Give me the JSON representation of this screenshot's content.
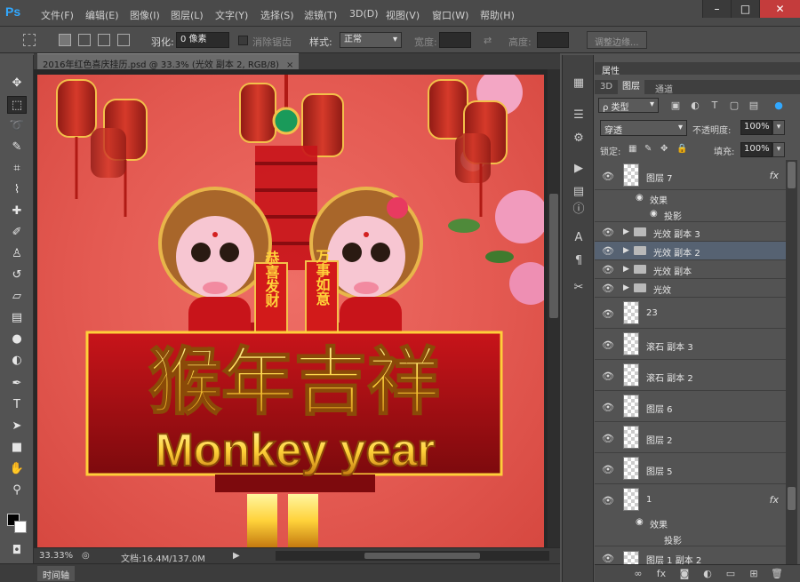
{
  "app": {
    "logo": "Ps",
    "menu": [
      "文件(F)",
      "编辑(E)",
      "图像(I)",
      "图层(L)",
      "文字(Y)",
      "选择(S)",
      "滤镜(T)",
      "3D(D)",
      "视图(V)",
      "窗口(W)",
      "帮助(H)"
    ],
    "window_buttons": [
      "–",
      "□",
      "✕"
    ]
  },
  "options": {
    "feather_label": "羽化:",
    "feather_value": "0 像素",
    "antialias_label": "消除锯齿",
    "style_label": "样式:",
    "style_value": "正常",
    "width_label": "宽度:",
    "height_label": "高度:",
    "refine_edge_label": "调整边缘..."
  },
  "document": {
    "tab_title": "2016年红色喜庆挂历.psd @ 33.3% (光效 副本 2, RGB/8)",
    "close": "×",
    "artwork": {
      "title_cn": "猴年吉祥",
      "title_en": "Monkey year",
      "scroll_left": "恭喜发财",
      "scroll_right": "万事如意"
    }
  },
  "status": {
    "zoom": "33.33%",
    "doc_info": "文档:16.4M/137.0M",
    "arrow": "▶"
  },
  "timeline": {
    "tab": "时间轴"
  },
  "panel": {
    "header": "属性",
    "tabs": [
      "3D",
      "图层",
      "通道"
    ],
    "active_tab": "图层",
    "kind_filter": "ρ 类型",
    "blend_mode": "穿透",
    "opacity_label": "不透明度:",
    "opacity_value": "100%",
    "lock_label": "锁定:",
    "fill_label": "填充:",
    "fill_value": "100%",
    "dropdown_arrow": "▾",
    "fx_label": "fx",
    "layers": [
      {
        "name": "图层 7",
        "type": "layer",
        "fx": true
      },
      {
        "name": "效果",
        "type": "effect"
      },
      {
        "name": "投影",
        "type": "subeffect"
      },
      {
        "name": "光效 副本 3",
        "type": "group"
      },
      {
        "name": "光效 副本 2",
        "type": "group",
        "selected": true
      },
      {
        "name": "光效 副本",
        "type": "group"
      },
      {
        "name": "光效",
        "type": "group"
      },
      {
        "name": "23",
        "type": "layer"
      },
      {
        "name": "滚石 副本 3",
        "type": "layer"
      },
      {
        "name": "滚石 副本 2",
        "type": "layer"
      },
      {
        "name": "图层 6",
        "type": "layer"
      },
      {
        "name": "图层 2",
        "type": "layer"
      },
      {
        "name": "图层 5",
        "type": "layer"
      },
      {
        "name": "1",
        "type": "layer",
        "fx": true
      },
      {
        "name": "效果",
        "type": "effect"
      },
      {
        "name": "投影",
        "type": "subeffect"
      },
      {
        "name": "图层 1 副本 2",
        "type": "layer"
      }
    ]
  },
  "colors": {
    "accent": "#31a8ff",
    "selected_layer": "#566272",
    "canvas_red": "#e45a52",
    "title_gold": "#ffd23a"
  }
}
